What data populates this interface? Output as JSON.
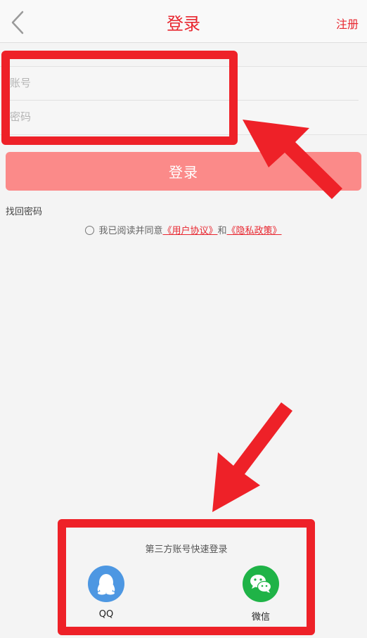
{
  "nav": {
    "title": "登录",
    "register_label": "注册",
    "back_icon": "chevron-left-icon"
  },
  "form": {
    "account_placeholder": "账号",
    "password_placeholder": "密码"
  },
  "login_button_label": "登录",
  "forgot_password_label": "找回密码",
  "agreement": {
    "prefix": "我已阅读并同意",
    "user_agreement": "《用户协议》",
    "conjunction": "和",
    "privacy_policy": "《隐私政策》",
    "checked": false
  },
  "third_party": {
    "title": "第三方账号快速登录",
    "options": [
      {
        "label": "QQ",
        "icon": "qq-icon",
        "color": "#4d97e2"
      },
      {
        "label": "微信",
        "icon": "wechat-icon",
        "color": "#1fb347"
      }
    ]
  },
  "colors": {
    "accent": "#e8262f",
    "login_button": "#fb8a89",
    "annotation": "#ee2128"
  }
}
